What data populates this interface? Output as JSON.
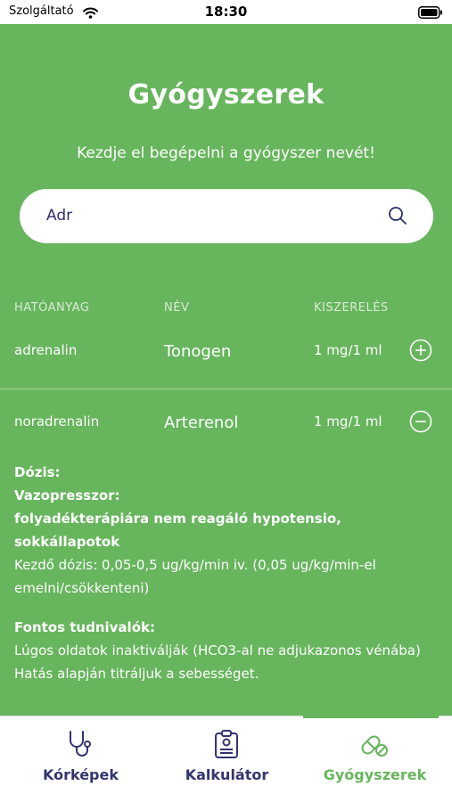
{
  "status": {
    "carrier": "Szolgáltató",
    "time": "18:30"
  },
  "page": {
    "title": "Gyógyszerek",
    "subtitle": "Kezdje el begépelni a gyógyszer nevét!"
  },
  "search": {
    "value": "Adr",
    "icon": "search-icon"
  },
  "table": {
    "columns": [
      "HATÓANYAG",
      "NÉV",
      "KISZERELÉS"
    ],
    "rows": [
      {
        "substance": "adrenalin",
        "name": "Tonogen",
        "package": "1 mg/1 ml",
        "state_icon": "plus-circle-icon"
      },
      {
        "substance": "noradrenalin",
        "name": "Arterenol",
        "package": "1 mg/1 ml",
        "state_icon": "minus-circle-icon"
      }
    ]
  },
  "details": {
    "dose_heading": "Dózis:",
    "category": "Vazopresszor:",
    "indication": "folyadékterápiára nem reagáló hypotensio, sokkállapotok",
    "starting_dose": "Kezdő dózis: 0,05-0,5 ug/kg/min iv. (0,05 ug/kg/min-el emelni/csökkenteni)",
    "notes_heading": "Fontos tudnivalók:",
    "note_1": "Lúgos oldatok inaktiválják (HCO3-al ne adjukazonos vénába)",
    "note_2": "Hatás alapján titráljuk a sebességet."
  },
  "tabs": [
    {
      "label": "Kórképek",
      "icon": "stethoscope-icon",
      "active": false
    },
    {
      "label": "Kalkulátor",
      "icon": "clipboard-icon",
      "active": false
    },
    {
      "label": "Gyógyszerek",
      "icon": "pill-icon",
      "active": true
    }
  ],
  "colors": {
    "accent": "#67b55d",
    "tab_text": "#34346e",
    "search_text": "#2e2e6e"
  }
}
